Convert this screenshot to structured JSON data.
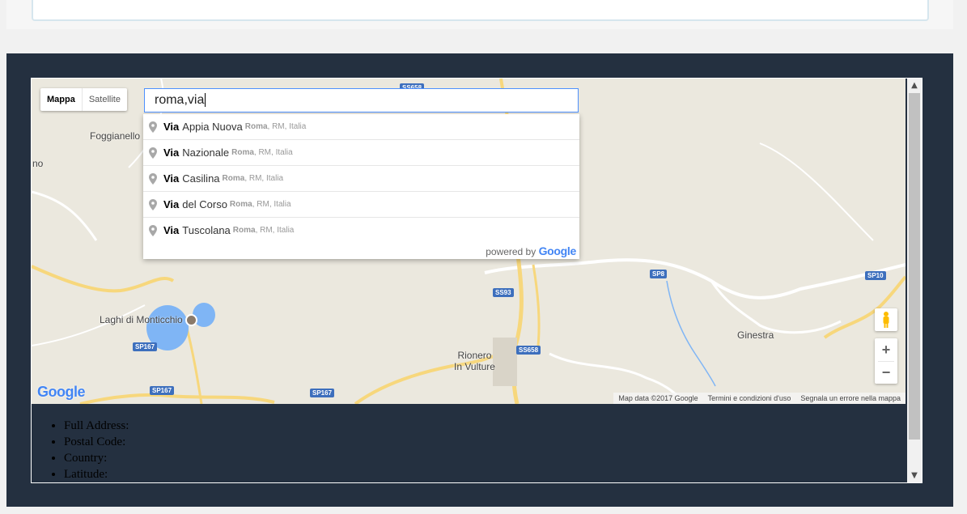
{
  "map_type": {
    "map_label": "Mappa",
    "satellite_label": "Satellite"
  },
  "search": {
    "value": "roma,via"
  },
  "suggestions": [
    {
      "match": "Via",
      "rest": "Appia Nuova",
      "city": "Roma",
      "region": ", RM, Italia"
    },
    {
      "match": "Via",
      "rest": "Nazionale",
      "city": "Roma",
      "region": ", RM, Italia"
    },
    {
      "match": "Via",
      "rest": "Casilina",
      "city": "Roma",
      "region": ", RM, Italia"
    },
    {
      "match": "Via",
      "rest": "del Corso",
      "city": "Roma",
      "region": ", RM, Italia"
    },
    {
      "match": "Via",
      "rest": "Tuscolana",
      "city": "Roma",
      "region": ", RM, Italia"
    }
  ],
  "powered_by": {
    "text": "powered by",
    "brand": "Google"
  },
  "map_labels": {
    "foggianello": "Foggianello",
    "no": "no",
    "laghi": "Laghi di Monticchio",
    "rionero_1": "Rionero",
    "rionero_2": "In Vulture",
    "ginestra": "Ginestra"
  },
  "road_shields": {
    "ss658_top": "SS658",
    "ss93": "SS93",
    "ss658": "SS658",
    "sp8": "SP8",
    "sp10": "SP10",
    "sp167_a": "SP167",
    "sp167_b": "SP167",
    "sp167_c": "SP167"
  },
  "zoom": {
    "in": "+",
    "out": "−"
  },
  "google_logo": "Google",
  "attribution": {
    "map_data": "Map data ©2017 Google",
    "terms": "Termini e condizioni d'uso",
    "report": "Segnala un errore nella mappa"
  },
  "info_list": [
    "Full Address:",
    "Postal Code:",
    "Country:",
    "Latitude:"
  ],
  "colors": {
    "dark_panel": "#243040",
    "map_bg": "#ebe8de",
    "road_yellow": "#f7d77c",
    "water": "#7fb5f5",
    "shield_blue": "#3d6fbd",
    "search_border": "#4d90fe"
  }
}
